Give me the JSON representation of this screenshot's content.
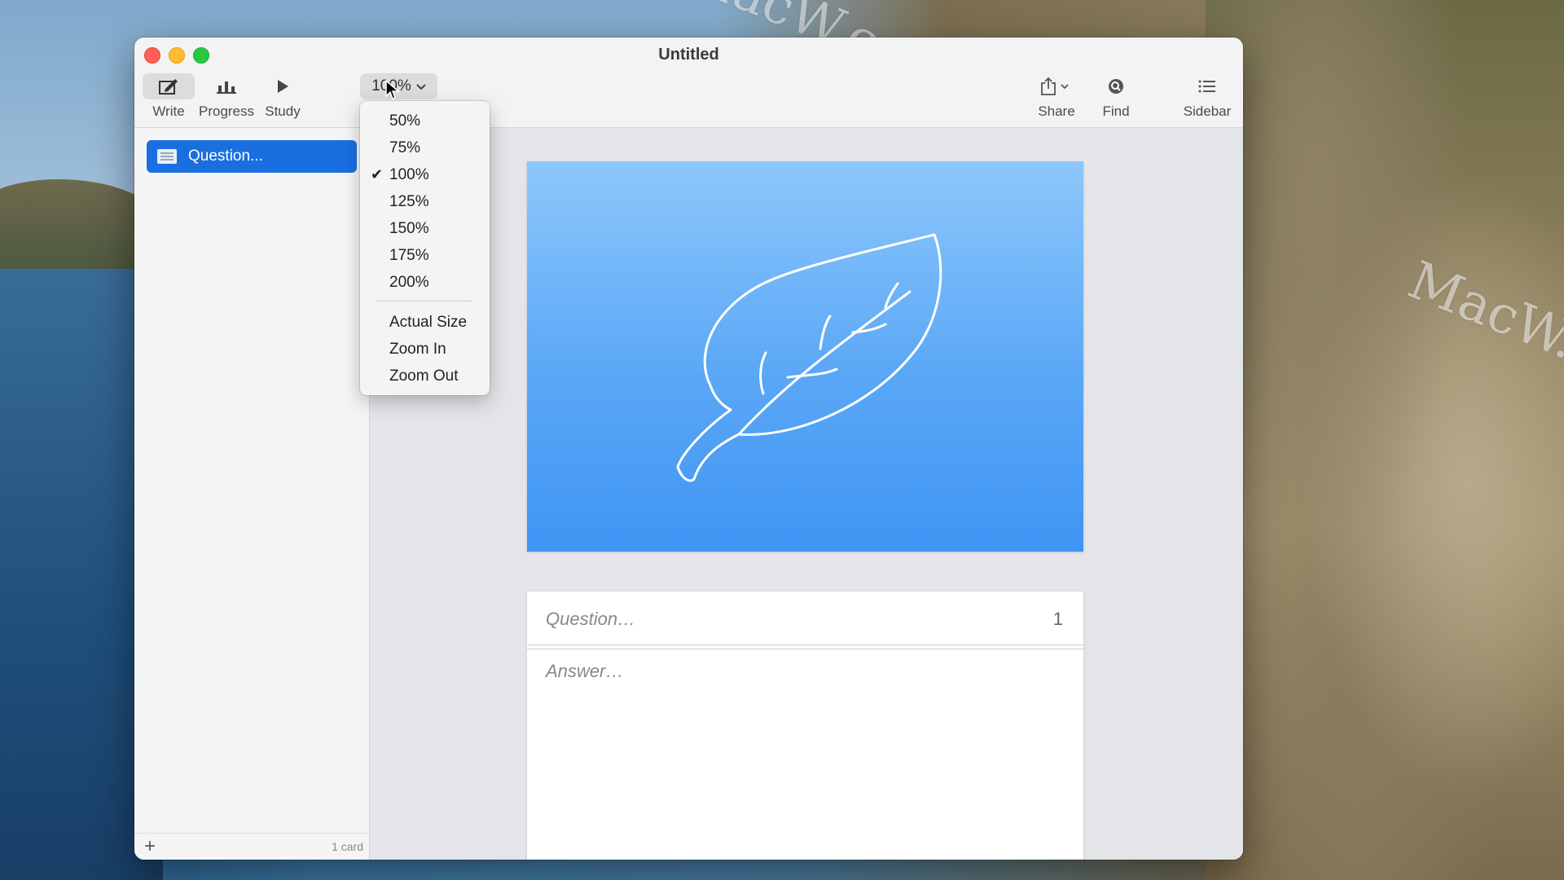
{
  "window": {
    "title": "Untitled"
  },
  "toolbar": {
    "write_label": "Write",
    "progress_label": "Progress",
    "study_label": "Study",
    "zoom_value": "100%",
    "share_label": "Share",
    "find_label": "Find",
    "sidebar_label": "Sidebar"
  },
  "zoom_menu": {
    "items": [
      "50%",
      "75%",
      "100%",
      "125%",
      "150%",
      "175%",
      "200%"
    ],
    "selected": "100%",
    "actions": [
      "Actual Size",
      "Zoom In",
      "Zoom Out"
    ]
  },
  "sidebar": {
    "items": [
      {
        "label": "Question..."
      }
    ],
    "footer_count": "1 card"
  },
  "card": {
    "question_placeholder": "Question…",
    "number": "1",
    "answer_placeholder": "Answer…"
  },
  "watermark": "MacW.com",
  "colors": {
    "accent": "#1a6fe0",
    "image_top": "#8dc7fb",
    "image_bottom": "#3f95f4"
  },
  "icons": [
    "pencil-icon",
    "chart-icon",
    "play-icon",
    "chevron-down-icon",
    "share-icon",
    "find-icon",
    "list-icon",
    "plus-icon",
    "leaf-icon",
    "document-icon",
    "checkmark-icon",
    "pointer-cursor-icon"
  ]
}
